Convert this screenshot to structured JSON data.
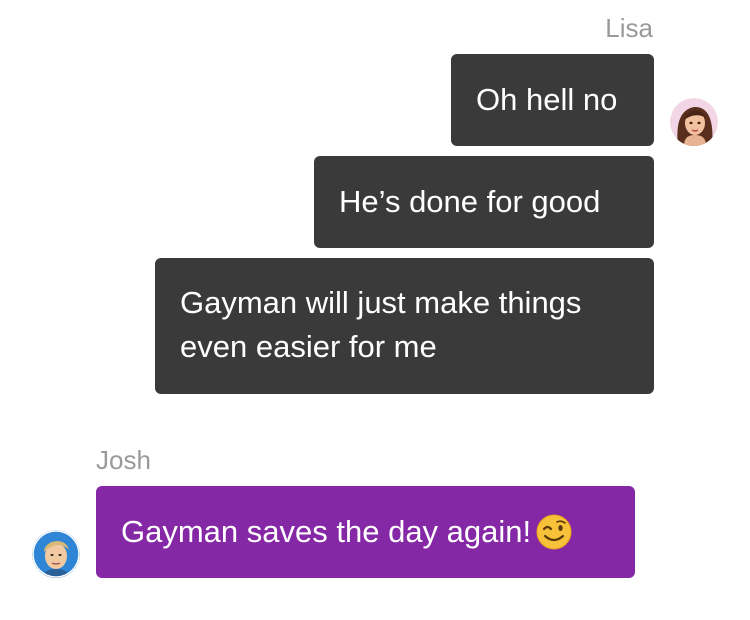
{
  "conversation": {
    "messages": [
      {
        "sender": "Lisa",
        "bubbles": [
          {
            "lines": [
              "Oh hell no"
            ]
          },
          {
            "lines": [
              "He’s done for good"
            ]
          },
          {
            "lines": [
              "Gayman will just make things",
              "even easier for me"
            ]
          }
        ],
        "avatar_icon": "woman-avatar-icon",
        "bubble_color": "#3a3a3a"
      },
      {
        "sender": "Josh",
        "bubbles": [
          {
            "lines": [
              "Gayman saves the day again!"
            ],
            "emoji_icon": "winking-face-icon"
          }
        ],
        "avatar_icon": "man-avatar-icon",
        "bubble_color": "#8528a6"
      }
    ]
  }
}
